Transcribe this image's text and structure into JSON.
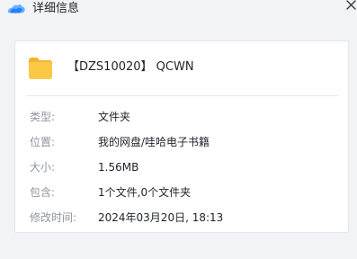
{
  "window": {
    "title": "详细信息",
    "logo_icon": "app-cloud-logo-icon",
    "close_icon": "close-icon"
  },
  "file": {
    "icon": "folder-icon",
    "name": "【DZS10020】 QCWN"
  },
  "details": [
    {
      "label": "类型:",
      "value": "文件夹"
    },
    {
      "label": "位置:",
      "value": "我的网盘/哇哈电子书籍"
    },
    {
      "label": "大小:",
      "value": "1.56MB"
    },
    {
      "label": "包含:",
      "value": "1个文件,0个文件夹"
    },
    {
      "label": "修改时间:",
      "value": "2024年03月20日, 18:13"
    }
  ],
  "colors": {
    "background": "#f2f3f5",
    "card": "#ffffff",
    "label": "#8f959e",
    "value": "#1f2329",
    "folder": "#f9c13c",
    "logo_blue": "#2f7df6",
    "logo_light": "#5fb4ff"
  }
}
